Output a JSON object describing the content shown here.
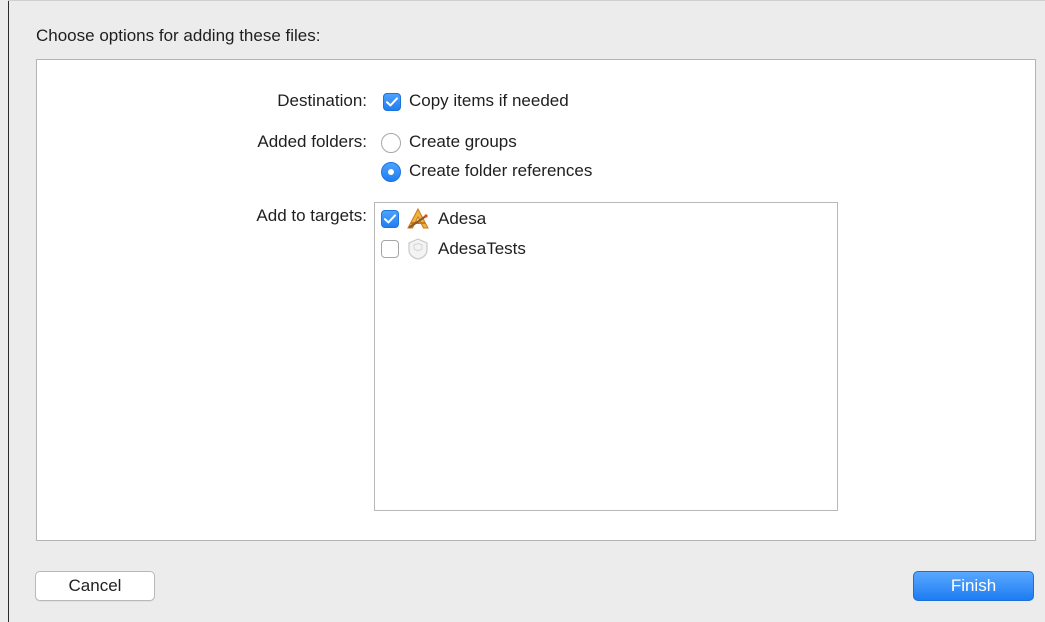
{
  "dialog": {
    "title": "Choose options for adding these files:"
  },
  "destination": {
    "label": "Destination:",
    "option_label": "Copy items if needed",
    "checked": true
  },
  "added_folders": {
    "label": "Added folders:",
    "options": [
      {
        "label": "Create groups",
        "selected": false
      },
      {
        "label": "Create folder references",
        "selected": true
      }
    ]
  },
  "targets": {
    "label": "Add to targets:",
    "items": [
      {
        "name": "Adesa",
        "checked": true,
        "icon": "app-target-icon"
      },
      {
        "name": "AdesaTests",
        "checked": false,
        "icon": "test-bundle-icon"
      }
    ]
  },
  "buttons": {
    "cancel": "Cancel",
    "finish": "Finish"
  },
  "colors": {
    "accent": "#1f7ef0",
    "dialog_bg": "#ececec",
    "panel_bg": "#ffffff"
  }
}
